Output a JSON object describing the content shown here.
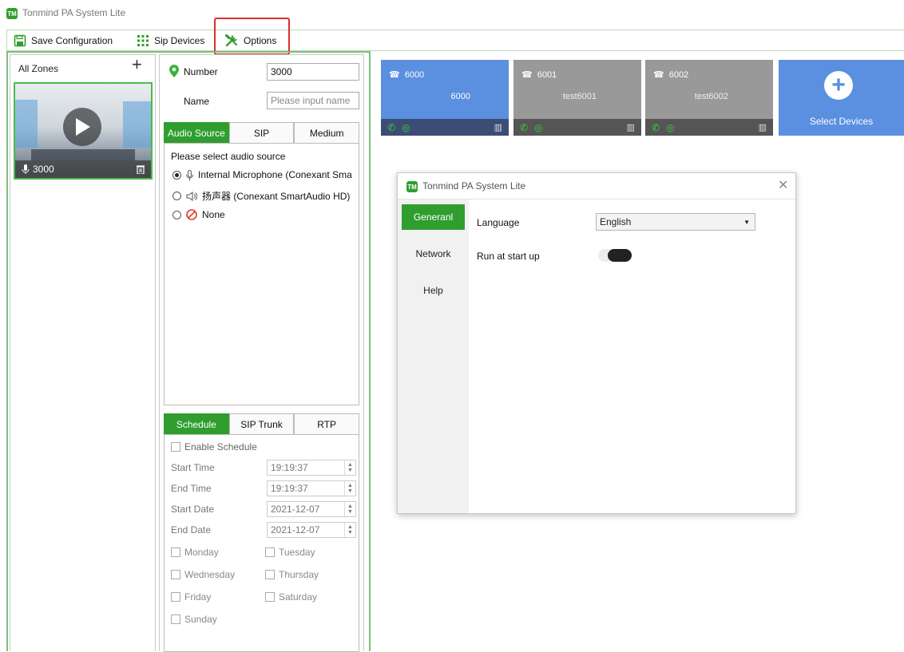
{
  "app": {
    "title": "Tonmind PA System Lite",
    "logo_text": "TM"
  },
  "toolbar": {
    "save_label": "Save Configuration",
    "sip_devices_label": "Sip Devices",
    "options_label": "Options"
  },
  "zones": {
    "title": "All Zones",
    "add_symbol": "+",
    "card": {
      "number": "3000"
    }
  },
  "config": {
    "number_label": "Number",
    "number_value": "3000",
    "name_label": "Name",
    "name_placeholder": "Please input name",
    "tabs1": [
      "Audio Source",
      "SIP",
      "Medium"
    ],
    "audio_prompt": "Please select audio source",
    "audio_options": [
      {
        "label": "Internal Microphone (Conexant Sma",
        "selected": true
      },
      {
        "label": "扬声器 (Conexant SmartAudio HD)",
        "selected": false
      },
      {
        "label": "None",
        "selected": false
      }
    ],
    "tabs2": [
      "Schedule",
      "SIP Trunk",
      "RTP"
    ],
    "enable_schedule_label": "Enable Schedule",
    "start_time_label": "Start Time",
    "start_time_value": "19:19:37",
    "end_time_label": "End Time",
    "end_time_value": "19:19:37",
    "start_date_label": "Start Date",
    "start_date_value": "2021-12-07",
    "end_date_label": "End Date",
    "end_date_value": "2021-12-07",
    "days": [
      "Monday",
      "Tuesday",
      "Wednesday",
      "Thursday",
      "Friday",
      "Saturday",
      "Sunday"
    ]
  },
  "devices": [
    {
      "number": "6000",
      "name": "6000",
      "active": true
    },
    {
      "number": "6001",
      "name": "test6001",
      "active": false
    },
    {
      "number": "6002",
      "name": "test6002",
      "active": false
    }
  ],
  "select_devices": {
    "label": "Select Devices",
    "plus": "+"
  },
  "dialog": {
    "title": "Tonmind PA System Lite",
    "close": "✕",
    "nav": [
      "Generanl",
      "Network",
      "Help"
    ],
    "language_label": "Language",
    "language_value": "English",
    "run_at_startup_label": "Run at start up"
  },
  "colors": {
    "accent_green": "#2f9e2f",
    "device_blue": "#5b8fe0",
    "highlight_red": "#d9302c"
  }
}
